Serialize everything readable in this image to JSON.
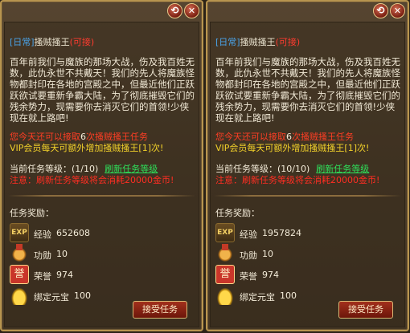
{
  "buttons": {
    "restore": "⟲",
    "close": "✕",
    "accept": "接受任务"
  },
  "quest": {
    "tag": "[日常]",
    "name": "搔贼搔王",
    "state": "(可接)",
    "description": "百年前我们与魔族的那场大战，伤及我百姓无数，此仇永世不共戴天！我们的先人将魔族怪物都封印在各地的宫殿之中，但最近他们正跃跃欲试要重新争霸大陆，为了彻底摧毁它们的残余势力，现需要你去消灭它们的首领!少侠现在就上路吧!",
    "daily_part1": "您今天还可以接取",
    "daily_count": "6",
    "daily_part2": "次搔贼搔王任务",
    "vip_line": "VIP会员每天可额外增加搔贼搔王[1]次!",
    "level_label": "当前任务等级：",
    "refresh_label": "刷新任务等级",
    "note": "注意：刷新任务等级将会消耗20000金币!",
    "rewards_title": "任务奖励：",
    "reward_labels": {
      "exp": "经验",
      "merit": "功勋",
      "honor": "荣誉",
      "ingot": "绑定元宝"
    }
  },
  "panels": [
    {
      "level": "(1/10)",
      "rewards": {
        "exp": "652608",
        "merit": "10",
        "honor": "974",
        "ingot": "100"
      }
    },
    {
      "level": "(10/10)",
      "rewards": {
        "exp": "1957824",
        "merit": "10",
        "honor": "974",
        "ingot": "100"
      }
    }
  ],
  "icons": {
    "exp": "EXP",
    "honor": "誉"
  },
  "colors": {
    "tag": "#4aa3e8",
    "state": "#ff3b2f",
    "refresh": "#2ee05a",
    "note": "#ff2e22",
    "vip": "#f2d12a"
  }
}
